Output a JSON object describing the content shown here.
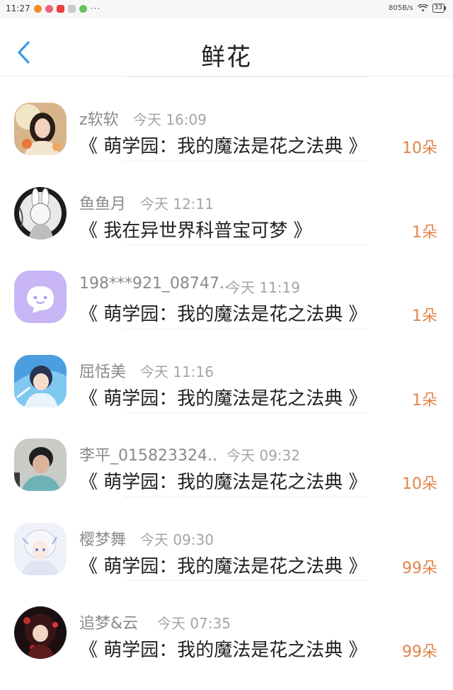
{
  "status_bar": {
    "time": "11:27",
    "more": "···",
    "speed": "805B/s",
    "battery": "33"
  },
  "header": {
    "title": "鲜花",
    "back_icon": "chevron-left-icon"
  },
  "colors": {
    "accent_back": "#3b9ae8",
    "count": "#e0854a"
  },
  "items": [
    {
      "username": "z软软",
      "time": "今天 16:09",
      "book": "《 萌学园：我的魔法是花之法典 》",
      "count": "10朵"
    },
    {
      "username": "鱼鱼月",
      "time": "今天 12:11",
      "book": "《 我在异世界科普宝可梦 》",
      "count": "1朵"
    },
    {
      "username": "198***921_08747..",
      "time": "今天 11:19",
      "book": "《 萌学园：我的魔法是花之法典 》",
      "count": "1朵"
    },
    {
      "username": "屈恬美",
      "time": "今天 11:16",
      "book": "《 萌学园：我的魔法是花之法典 》",
      "count": "1朵"
    },
    {
      "username": "李平_015823324..",
      "time": "今天 09:32",
      "book": "《 萌学园：我的魔法是花之法典 》",
      "count": "10朵"
    },
    {
      "username": "樱梦舞",
      "time": "今天 09:30",
      "book": "《 萌学园：我的魔法是花之法典 》",
      "count": "99朵"
    },
    {
      "username": "追梦&云",
      "time": "今天 07:35",
      "book": "《 萌学园：我的魔法是花之法典 》",
      "count": "99朵"
    }
  ]
}
